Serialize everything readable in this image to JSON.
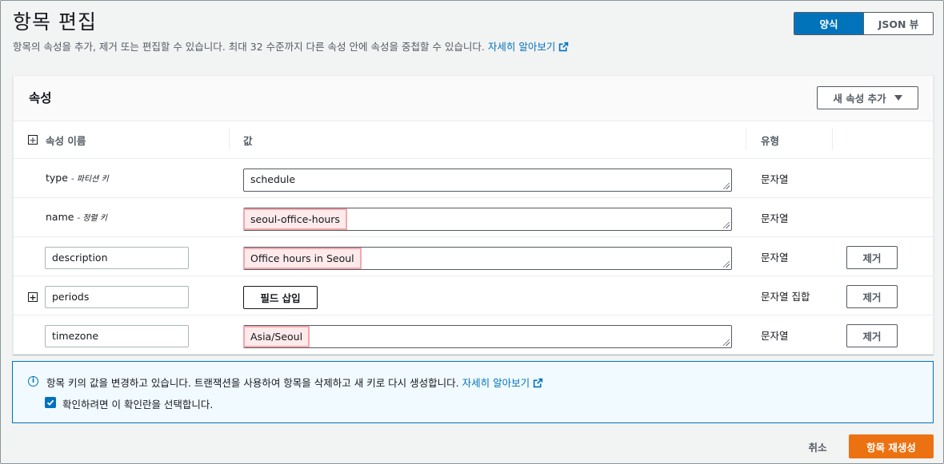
{
  "header": {
    "title": "항목 편집",
    "subtitle": "항목의 속성을 추가, 제거 또는 편집할 수 있습니다. 최대 32 수준까지 다른 속성 안에 속성을 중첩할 수 있습니다.",
    "learn_more": "자세히 알아보기",
    "view_toggle": {
      "form": "양식",
      "json": "JSON 뷰",
      "selected": "양식"
    }
  },
  "attributes_panel": {
    "title": "속성",
    "add_button": "새 속성 추가",
    "columns": {
      "name": "속성 이름",
      "value": "값",
      "type": "유형"
    },
    "rows": [
      {
        "name": "type",
        "key_note": "- 파티션 키",
        "value": "schedule",
        "type": "문자열"
      },
      {
        "name": "name",
        "key_note": "- 정렬 키",
        "value": "seoul-office-hours",
        "type": "문자열"
      },
      {
        "name": "description",
        "value": "Office hours in Seoul",
        "type": "문자열",
        "remove": "제거"
      },
      {
        "name": "periods",
        "insert_button": "필드 삽입",
        "type": "문자열 집합",
        "remove": "제거"
      },
      {
        "name": "timezone",
        "value": "Asia/Seoul",
        "type": "문자열",
        "remove": "제거"
      }
    ]
  },
  "alert": {
    "message": "항목 키의 값을 변경하고 있습니다. 트랜잭션을 사용하여 항목을 삭제하고 새 키로 다시 생성합니다.",
    "learn_more": "자세히 알아보기",
    "checkbox_label": "확인하려면 이 확인란을 선택합니다.",
    "checkbox_checked": true
  },
  "footer": {
    "cancel": "취소",
    "primary": "항목 재생성"
  },
  "colors": {
    "accent": "#0073bb",
    "primary": "#ec7211",
    "highlight": "#f5a7ac"
  }
}
